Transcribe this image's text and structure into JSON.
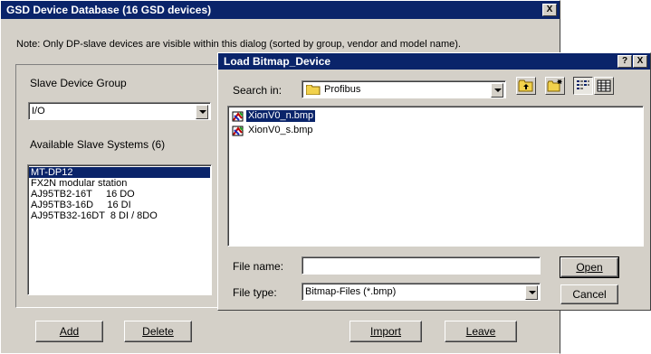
{
  "gsd_window": {
    "title": "GSD Device Database (16 GSD devices)",
    "close_glyph": "X",
    "note": "Note: Only DP-slave devices are visible within this dialog (sorted by group, vendor and model name).",
    "slave_group_label": "Slave Device Group",
    "slave_group_value": "I/O",
    "available_label": "Available Slave Systems (6)",
    "slave_list": [
      "MT-DP12",
      "FX2N modular station",
      "AJ95TB2-16T     16 DO",
      "AJ95TB3-16D     16 DI",
      "AJ95TB32-16DT  8 DI / 8DO"
    ],
    "selected_index": 0,
    "add_label": "Add",
    "delete_label": "Delete",
    "import_label": "Import",
    "leave_label": "Leave"
  },
  "load_dialog": {
    "title": "Load Bitmap_Device",
    "help_glyph": "?",
    "close_glyph": "X",
    "search_in_label": "Search in:",
    "search_in_value": "Profibus",
    "files": [
      "XionV0_n.bmp",
      "XionV0_s.bmp"
    ],
    "selected_file_index": 0,
    "file_name_label": "File name:",
    "file_name_value": "",
    "file_type_label": "File type:",
    "file_type_value": "Bitmap-Files (*.bmp)",
    "open_label": "Open",
    "cancel_label": "Cancel"
  },
  "colors": {
    "title_bar": "#0a246a",
    "face": "#d4d0c8",
    "selection": "#0a246a"
  },
  "icons": [
    "close-icon",
    "help-icon",
    "folder-icon",
    "up-folder-icon",
    "new-folder-icon",
    "list-view-icon",
    "details-view-icon",
    "bitmap-file-icon",
    "dropdown-arrow-icon"
  ]
}
